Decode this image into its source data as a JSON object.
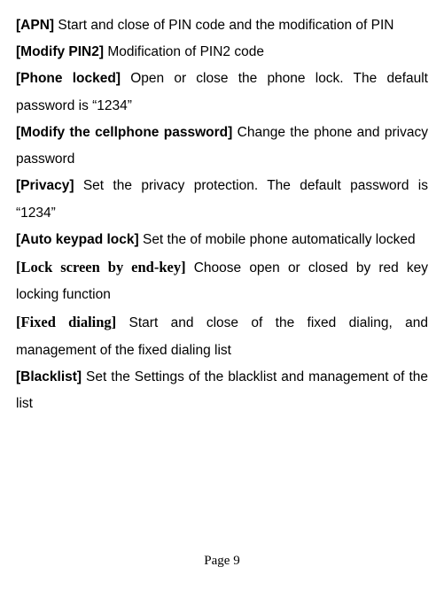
{
  "entries": [
    {
      "label": "[APN]",
      "label_serif": false,
      "desc": " Start and close of PIN code and the modification of PIN"
    },
    {
      "label": "[Modify PIN2]",
      "label_serif": false,
      "desc": " Modification of PIN2 code"
    },
    {
      "label": "[Phone locked]",
      "label_serif": false,
      "desc": " Open or close the phone lock. The default password is “1234”"
    },
    {
      "label": "[Modify the cellphone password]",
      "label_serif": false,
      "desc": " Change the phone and privacy password"
    },
    {
      "label": "[Privacy]",
      "label_serif": false,
      "desc": " Set the privacy protection. The default password is “1234”"
    },
    {
      "label": "[Auto keypad lock]",
      "label_serif": false,
      "desc": " Set the of mobile phone automatically locked"
    },
    {
      "label": "[Lock screen by end-key]",
      "label_serif": true,
      "desc": " Choose open or closed by red key locking function"
    },
    {
      "label": "[Fixed dialing]",
      "label_serif": true,
      "desc": " Start and close of the fixed dialing, and management of the fixed dialing list"
    },
    {
      "label": "[Blacklist]",
      "label_serif": false,
      "desc": " Set the Settings of the blacklist and management of the list"
    }
  ],
  "footer": "Page 9"
}
